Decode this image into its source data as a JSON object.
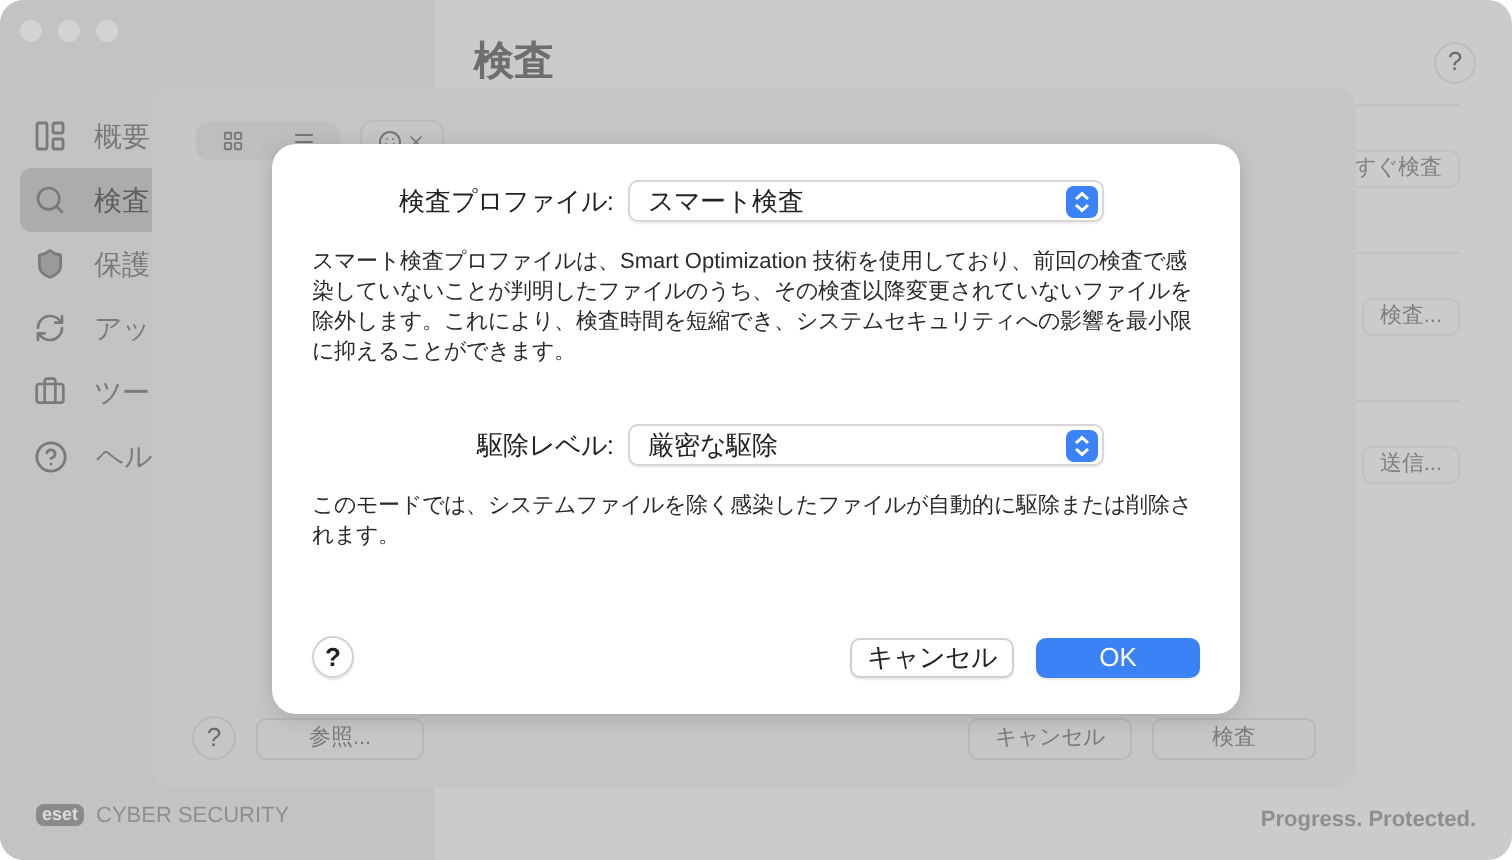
{
  "sidebar": {
    "items": [
      {
        "label": "概要",
        "selected": false
      },
      {
        "label": "検査",
        "selected": true
      },
      {
        "label": "保護",
        "selected": false
      },
      {
        "label": "アッ",
        "selected": false
      },
      {
        "label": "ツー",
        "selected": false
      },
      {
        "label": "ヘル",
        "selected": false
      }
    ],
    "logo": "eset",
    "brand": "CYBER SECURITY"
  },
  "main": {
    "title": "検査",
    "help": "?",
    "actions": [
      "すぐ検査",
      "検査...",
      "送信..."
    ],
    "tagline": "Progress. Protected."
  },
  "sheet": {
    "help": "?",
    "left_buttons": [
      "参照..."
    ],
    "right_buttons": [
      "キャンセル",
      "検査"
    ]
  },
  "dialog": {
    "fields": [
      {
        "label": "検査プロファイル:",
        "value": "スマート検査",
        "description": "スマート検査プロファイルは、Smart Optimization 技術を使用しており、前回の検査で感染していないことが判明したファイルのうち、その検査以降変更されていないファイルを除外します。これにより、検査時間を短縮でき、システムセキュリティへの影響を最小限に抑えることができます。"
      },
      {
        "label": "駆除レベル:",
        "value": "厳密な駆除",
        "description": "このモードでは、システムファイルを除く感染したファイルが自動的に駆除または削除されます。"
      }
    ],
    "help": "?",
    "buttons": [
      {
        "label": "キャンセル",
        "kind": "secondary"
      },
      {
        "label": "OK",
        "kind": "primary"
      }
    ]
  }
}
